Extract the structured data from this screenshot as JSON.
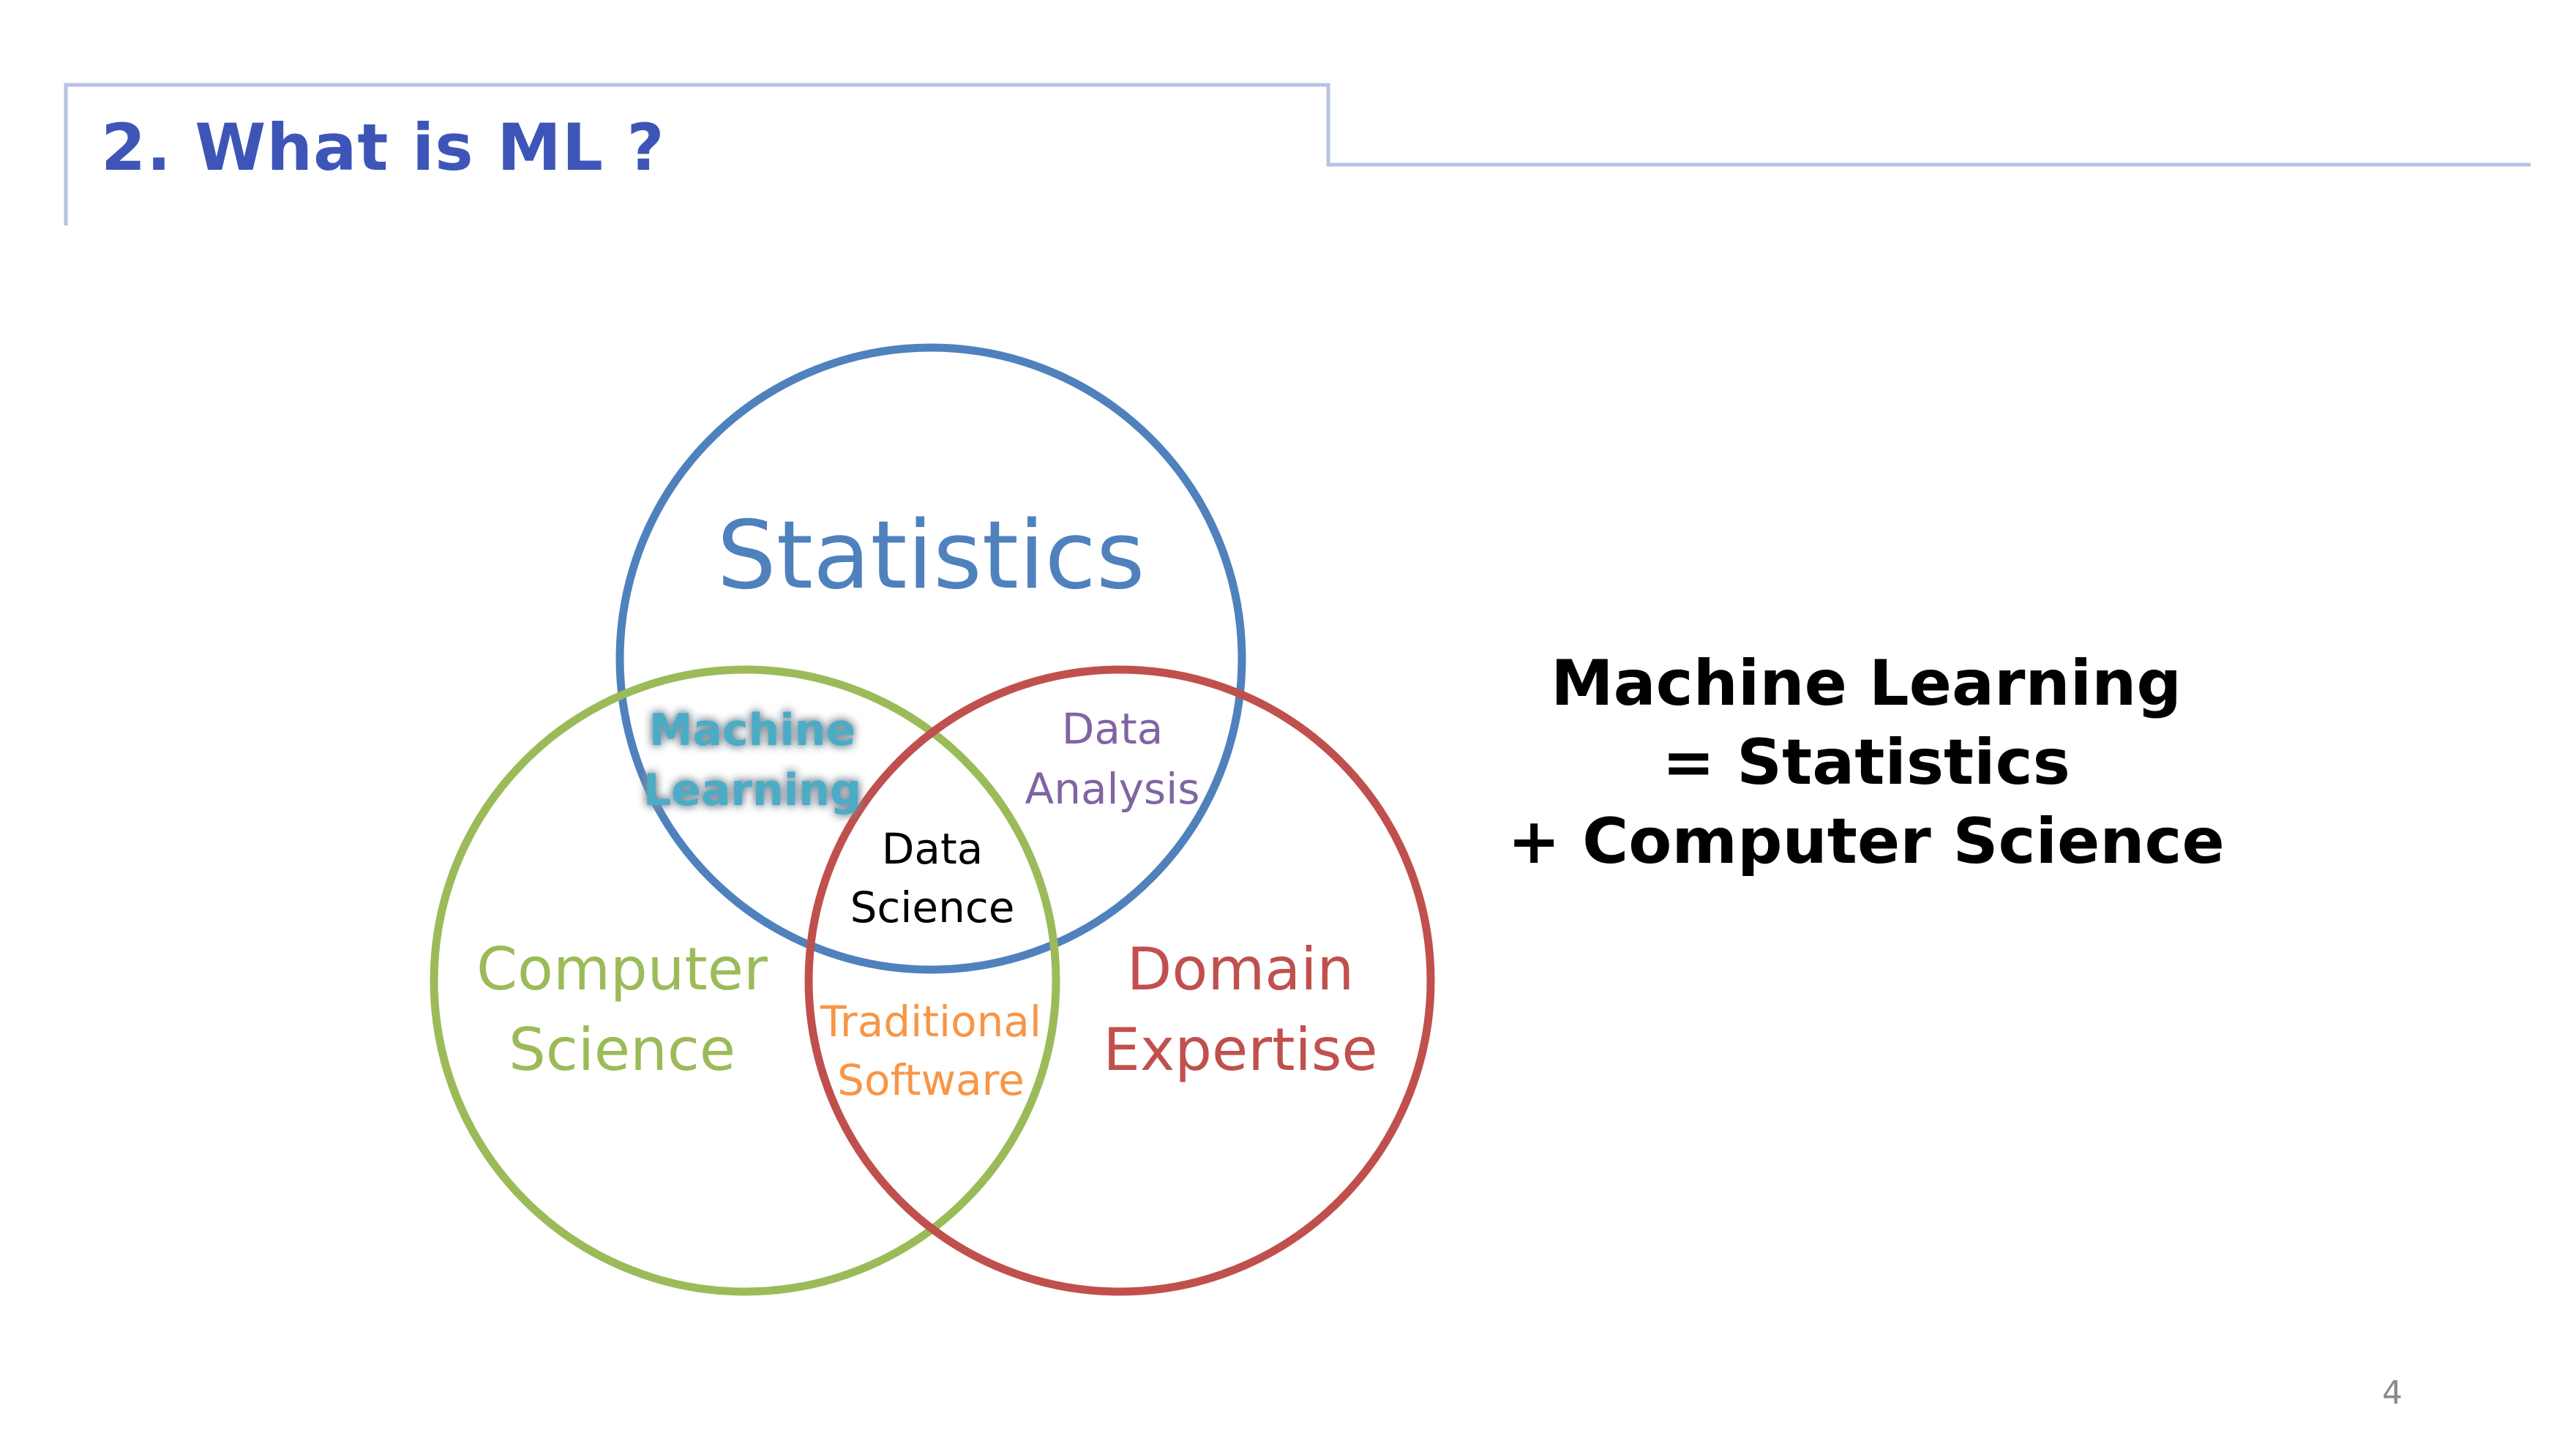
{
  "slide": {
    "title": "2. What is ML ?",
    "page_number": "4",
    "colors": {
      "title": "#3e55b8",
      "frame_line": "#b7c3e3"
    }
  },
  "diagram": {
    "sets": [
      {
        "key": "statistics",
        "label_lines": [
          "Statistics"
        ],
        "color": "#4f81bd"
      },
      {
        "key": "computer_science",
        "label_lines": [
          "Computer",
          "Science"
        ],
        "color": "#9bbb59"
      },
      {
        "key": "domain_expertise",
        "label_lines": [
          "Domain",
          "Expertise"
        ],
        "color": "#c0504d"
      }
    ],
    "intersections": [
      {
        "key": "machine_learning",
        "label_lines": [
          "Machine",
          "Learning"
        ],
        "color": "#4bacc6"
      },
      {
        "key": "data_analysis",
        "label_lines": [
          "Data",
          "Analysis"
        ],
        "color": "#8064a2"
      },
      {
        "key": "traditional_software",
        "label_lines": [
          "Traditional",
          "Software"
        ],
        "color": "#f79646"
      },
      {
        "key": "data_science",
        "label_lines": [
          "Data",
          "Science"
        ],
        "color": "#000000"
      }
    ]
  },
  "equation": {
    "lines": [
      "Machine Learning",
      "= Statistics",
      "+ Computer Science"
    ]
  }
}
